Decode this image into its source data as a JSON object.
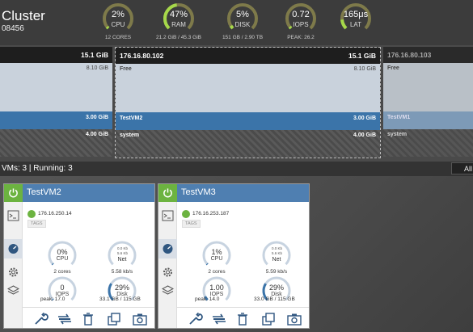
{
  "cluster": {
    "title": "Cluster",
    "id": "08456"
  },
  "gauges": [
    {
      "value": "2%",
      "label": "CPU",
      "sub": "12 CORES",
      "fraction": 0.02
    },
    {
      "value": "47%",
      "label": "RAM",
      "sub": "21.2 GiB / 45.3 GiB",
      "fraction": 0.47
    },
    {
      "value": "5%",
      "label": "DISK",
      "sub": "151 GB / 2.90 TB",
      "fraction": 0.05
    },
    {
      "value": "0.72",
      "label": "IOPS",
      "sub": "PEAK: 26.2",
      "fraction": 0.03
    },
    {
      "value": "165μs",
      "label": "LAT",
      "sub": "",
      "fraction": 0.15
    }
  ],
  "hosts": [
    {
      "ip": "",
      "size": "15.1 GiB",
      "free_label": "",
      "free_size": "8.10 GiB",
      "vm_label": "",
      "vm_size": "3.00 GiB",
      "sys_label": "",
      "sys_size": "4.00 GiB"
    },
    {
      "ip": "176.16.80.102",
      "size": "15.1 GiB",
      "free_label": "Free",
      "free_size": "8.10 GiB",
      "vm_label": "TestVM2",
      "vm_size": "3.00 GiB",
      "sys_label": "system",
      "sys_size": "4.00 GiB"
    },
    {
      "ip": "176.16.80.103",
      "size": "",
      "free_label": "Free",
      "free_size": "",
      "vm_label": "TestVM1",
      "vm_size": "",
      "sys_label": "system",
      "sys_size": ""
    }
  ],
  "status": {
    "text": "VMs: 3 | Running: 3",
    "button": "All"
  },
  "vms": [
    {
      "name": "TestVM2",
      "ip": "176.16.250.14",
      "tags": "TAGS",
      "cpu": {
        "value": "0%",
        "label": "CPU",
        "sub": "2 cores",
        "fraction": 0.0
      },
      "net": {
        "up": "0.0 Kb",
        "down": "5.6 Kb",
        "label": "Net",
        "sub": "5.58 kb/s"
      },
      "iops": {
        "value": "0",
        "label": "IOPS",
        "sub": "peak: 17.0",
        "fraction": 0.0
      },
      "disk": {
        "value": "29%",
        "label": "Disk",
        "sub": "33.1 GB / 115 GB",
        "fraction": 0.29
      }
    },
    {
      "name": "TestVM3",
      "ip": "176.16.253.187",
      "tags": "TAGS",
      "cpu": {
        "value": "1%",
        "label": "CPU",
        "sub": "2 cores",
        "fraction": 0.01
      },
      "net": {
        "up": "0.0 Kb",
        "down": "5.6 Kb",
        "label": "Net",
        "sub": "5.59 kb/s"
      },
      "iops": {
        "value": "1.00",
        "label": "IOPS",
        "sub": "peak: 14.0",
        "fraction": 0.07
      },
      "disk": {
        "value": "29%",
        "label": "Disk",
        "sub": "33.0 GB / 115 GB",
        "fraction": 0.29
      }
    }
  ],
  "colors": {
    "gauge_bg": "#8c8c5a",
    "gauge_fg": "#a6d84a",
    "vm_bar": "#3b74a9",
    "power": "#6cb340",
    "card_gauge": "#c7d3e0",
    "card_gauge_fill": "#3b74a9"
  }
}
